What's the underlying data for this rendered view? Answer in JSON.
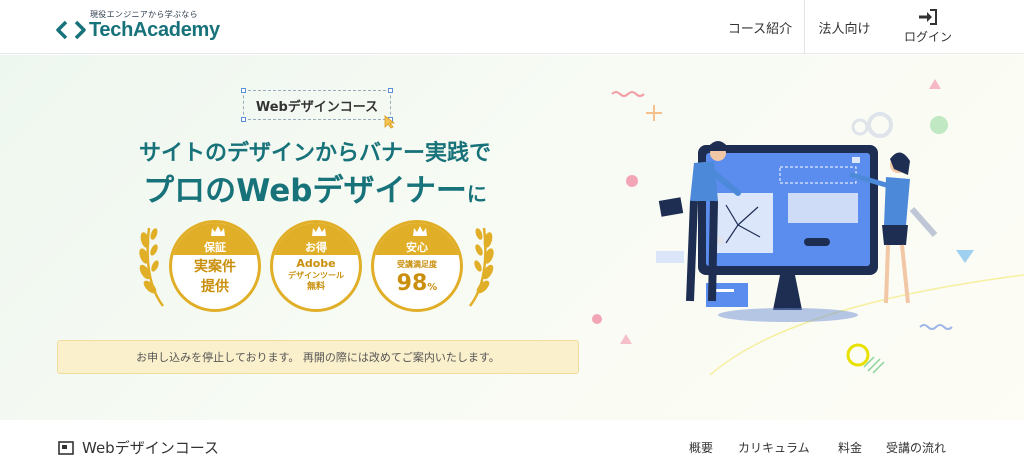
{
  "header": {
    "tagline": "現役エンジニアから学ぶなら",
    "brand": "TechAcademy",
    "nav": [
      {
        "label": "コース紹介"
      },
      {
        "label": "法人向け"
      },
      {
        "label": "ログイン",
        "icon": "login-icon"
      }
    ]
  },
  "hero": {
    "course_tag": "Webデザインコース",
    "headline_line1": "サイトのデザインからバナー実践で",
    "headline_line2_a": "プロの",
    "headline_line2_b": "Webデザイナー",
    "headline_line2_c": "に",
    "badges": [
      {
        "header": "保証",
        "lines": [
          "実案件",
          "提供"
        ]
      },
      {
        "header": "お得",
        "lines": [
          "Adobe",
          "デザインツール",
          "無料"
        ]
      },
      {
        "header": "安心",
        "lines": [
          "受講満足度",
          "98",
          "%"
        ]
      }
    ],
    "notice": "お申し込みを停止しております。 再開の際には改めてご案内いたします。"
  },
  "subnav": {
    "title": "Webデザインコース",
    "links": [
      "概要",
      "カリキュラム",
      "料金",
      "受講の流れ"
    ]
  },
  "colors": {
    "brand": "#17727a",
    "gold": "#e1ae28",
    "notice_bg": "#fbf0cc",
    "illustration_blue": "#2f5fb3"
  }
}
